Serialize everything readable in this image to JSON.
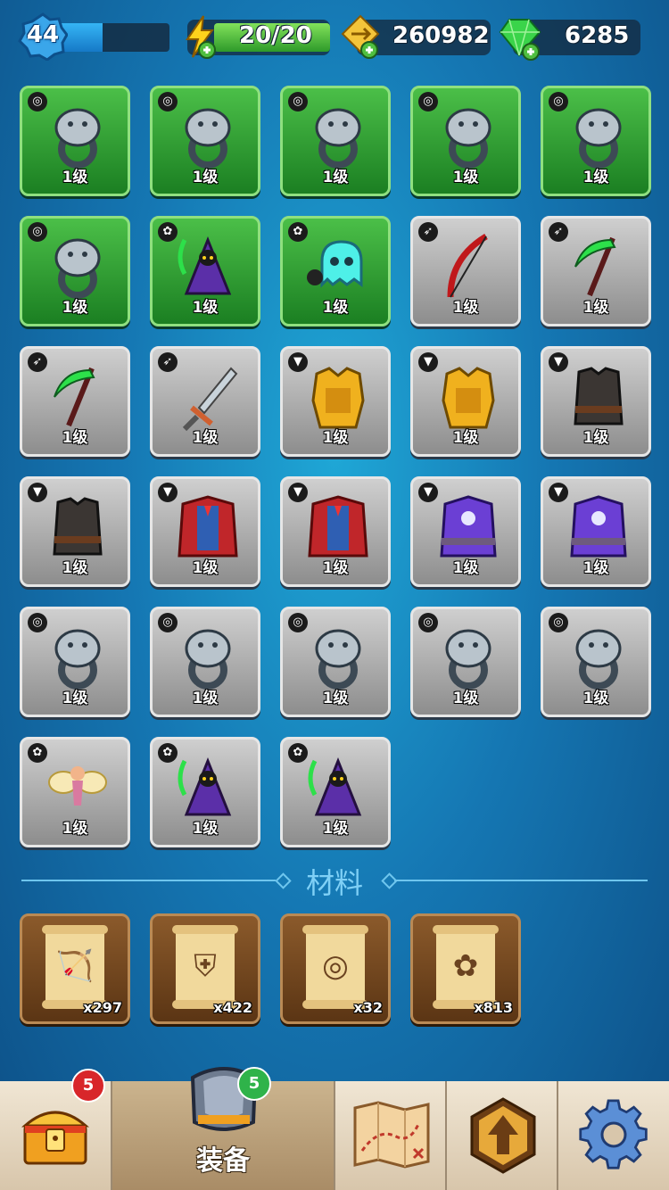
{
  "hud": {
    "level": "44",
    "xp_progress": 0.42,
    "energy": "20/20",
    "gold": "260982",
    "gems": "6285"
  },
  "colors": {
    "green_slot": "#2e9a35",
    "grey_slot": "#a9a9a9",
    "material_slot": "#6e4420",
    "badge_red": "#d8262a",
    "badge_green": "#2fb34a"
  },
  "equipment": {
    "items": [
      {
        "type": "ring",
        "rarity": "green",
        "icon": "bear-ring-icon",
        "level": "1级"
      },
      {
        "type": "ring",
        "rarity": "green",
        "icon": "bear-ring-icon",
        "level": "1级"
      },
      {
        "type": "ring",
        "rarity": "green",
        "icon": "wolf-ring-icon",
        "level": "1级"
      },
      {
        "type": "ring",
        "rarity": "green",
        "icon": "eagle-ring-icon",
        "level": "1级"
      },
      {
        "type": "ring",
        "rarity": "green",
        "icon": "snake-ring-icon",
        "level": "1级"
      },
      {
        "type": "ring",
        "rarity": "green",
        "icon": "snake-ring-icon",
        "level": "1级"
      },
      {
        "type": "pet",
        "rarity": "green",
        "icon": "reaper-pet-icon",
        "level": "1级"
      },
      {
        "type": "pet",
        "rarity": "green",
        "icon": "ghost-bomb-pet-icon",
        "level": "1级"
      },
      {
        "type": "weapon",
        "rarity": "grey",
        "icon": "red-bow-icon",
        "level": "1级"
      },
      {
        "type": "weapon",
        "rarity": "grey",
        "icon": "green-scythe-icon",
        "level": "1级"
      },
      {
        "type": "weapon",
        "rarity": "grey",
        "icon": "green-scythe-icon",
        "level": "1级"
      },
      {
        "type": "weapon",
        "rarity": "grey",
        "icon": "jagged-sword-icon",
        "level": "1级"
      },
      {
        "type": "armor",
        "rarity": "grey",
        "icon": "gold-armor-icon",
        "level": "1级"
      },
      {
        "type": "armor",
        "rarity": "grey",
        "icon": "gold-armor-icon",
        "level": "1级"
      },
      {
        "type": "armor",
        "rarity": "grey",
        "icon": "dark-vest-icon",
        "level": "1级"
      },
      {
        "type": "armor",
        "rarity": "grey",
        "icon": "dark-vest-icon",
        "level": "1级"
      },
      {
        "type": "armor",
        "rarity": "grey",
        "icon": "red-cape-armor-icon",
        "level": "1级"
      },
      {
        "type": "armor",
        "rarity": "grey",
        "icon": "red-cape-armor-icon",
        "level": "1级"
      },
      {
        "type": "armor",
        "rarity": "grey",
        "icon": "purple-robe-icon",
        "level": "1级"
      },
      {
        "type": "armor",
        "rarity": "grey",
        "icon": "purple-robe-icon",
        "level": "1级"
      },
      {
        "type": "ring",
        "rarity": "grey",
        "icon": "bear-ring-icon",
        "level": "1级"
      },
      {
        "type": "ring",
        "rarity": "grey",
        "icon": "bear-ring-icon",
        "level": "1级"
      },
      {
        "type": "ring",
        "rarity": "grey",
        "icon": "wolf-ring-icon",
        "level": "1级"
      },
      {
        "type": "ring",
        "rarity": "grey",
        "icon": "wolf-ring-icon",
        "level": "1级"
      },
      {
        "type": "ring",
        "rarity": "grey",
        "icon": "snake-ring-icon",
        "level": "1级"
      },
      {
        "type": "pet",
        "rarity": "grey",
        "icon": "fairy-pet-icon",
        "level": "1级"
      },
      {
        "type": "pet",
        "rarity": "grey",
        "icon": "reaper-pet-icon",
        "level": "1级"
      },
      {
        "type": "pet",
        "rarity": "grey",
        "icon": "reaper-pet-icon",
        "level": "1级"
      }
    ]
  },
  "materials": {
    "title": "材料",
    "items": [
      {
        "icon": "bow-scroll-icon",
        "count": "x297"
      },
      {
        "icon": "armor-scroll-icon",
        "count": "x422"
      },
      {
        "icon": "ring-scroll-icon",
        "count": "x32"
      },
      {
        "icon": "paw-scroll-icon",
        "count": "x813"
      }
    ]
  },
  "nav": {
    "chest_badge": "5",
    "equipment_label": "装备",
    "equipment_badge": "5",
    "items": [
      "chest-icon",
      "armor-helmet-icon",
      "map-icon",
      "upgrade-arrow-icon",
      "gear-icon"
    ]
  }
}
